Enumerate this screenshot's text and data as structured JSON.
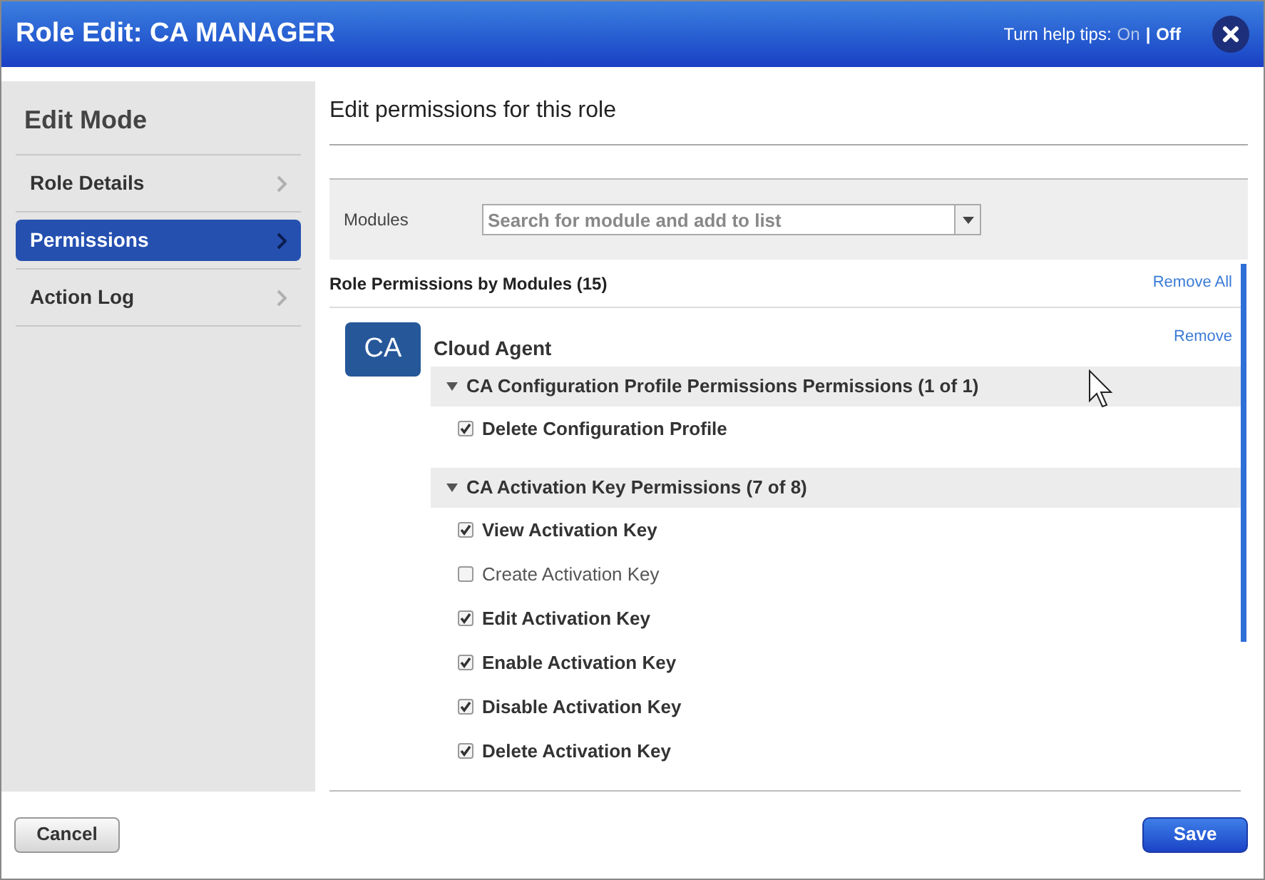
{
  "window": {
    "title": "Role Edit: CA MANAGER"
  },
  "help_tips": {
    "label": "Turn help tips:",
    "options": [
      {
        "label": "On",
        "selected": false
      },
      {
        "label": "Off",
        "selected": true
      }
    ],
    "separator": "|"
  },
  "sidebar": {
    "title": "Edit Mode",
    "items": [
      {
        "label": "Role Details",
        "selected": false
      },
      {
        "label": "Permissions",
        "selected": true
      },
      {
        "label": "Action Log",
        "selected": false
      }
    ]
  },
  "heading": "Edit permissions for this role",
  "modules_field": {
    "label": "Modules",
    "placeholder": "Search for module and add to list"
  },
  "permissions_header": {
    "title": "Role Permissions by Modules (15)",
    "action": "Remove All"
  },
  "module": {
    "badge": "CA",
    "name": "Cloud Agent",
    "action": "Remove",
    "groups": [
      {
        "title": "CA Configuration Profile Permissions Permissions (1 of 1)",
        "expanded": true,
        "items": [
          {
            "label": "Delete Configuration Profile",
            "checked": true
          }
        ]
      },
      {
        "title": "CA Activation Key Permissions (7 of 8)",
        "expanded": true,
        "items": [
          {
            "label": "View Activation Key",
            "checked": true
          },
          {
            "label": "Create Activation Key",
            "checked": false
          },
          {
            "label": "Edit Activation Key",
            "checked": true
          },
          {
            "label": "Enable Activation Key",
            "checked": true
          },
          {
            "label": "Disable Activation Key",
            "checked": true
          },
          {
            "label": "Delete Activation Key",
            "checked": true
          }
        ]
      }
    ]
  },
  "buttons": {
    "cancel": "Cancel",
    "save": "Save"
  }
}
